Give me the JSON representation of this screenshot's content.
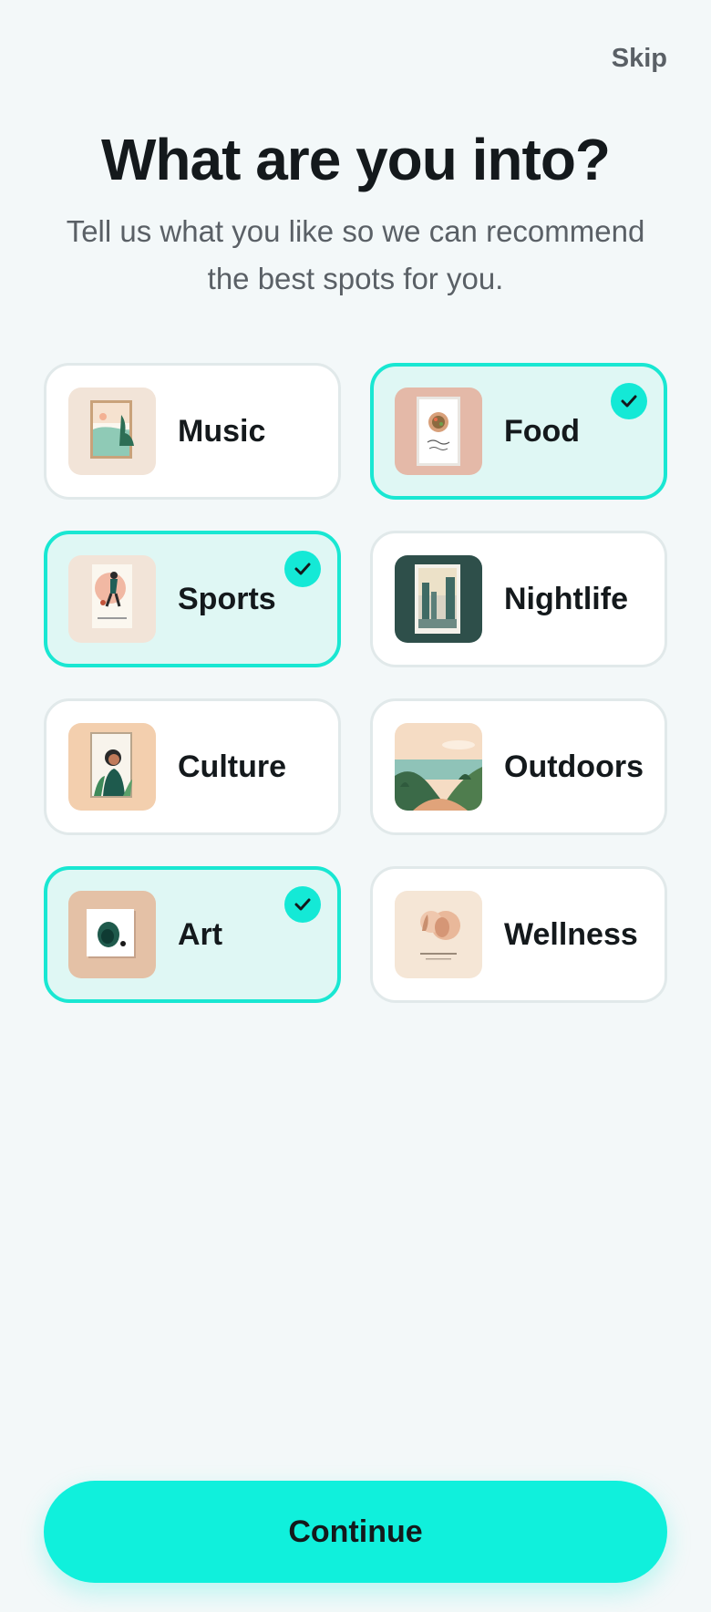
{
  "header": {
    "skip_label": "Skip",
    "title": "What are you into?",
    "subtitle": "Tell us what you like so we can recommend the best spots for you."
  },
  "categories": [
    {
      "label": "Music",
      "selected": false,
      "icon": "music-poster-icon"
    },
    {
      "label": "Food",
      "selected": true,
      "icon": "food-poster-icon"
    },
    {
      "label": "Sports",
      "selected": true,
      "icon": "sports-poster-icon"
    },
    {
      "label": "Nightlife",
      "selected": false,
      "icon": "nightlife-poster-icon"
    },
    {
      "label": "Culture",
      "selected": false,
      "icon": "culture-poster-icon"
    },
    {
      "label": "Outdoors",
      "selected": false,
      "icon": "outdoors-landscape-icon"
    },
    {
      "label": "Art",
      "selected": true,
      "icon": "art-poster-icon"
    },
    {
      "label": "Wellness",
      "selected": false,
      "icon": "wellness-poster-icon"
    }
  ],
  "footer": {
    "continue_label": "Continue"
  },
  "colors": {
    "accent": "#10f0dc",
    "selected_bg": "#dff7f4",
    "selected_border": "#19e7d2",
    "page_bg": "#f3f8f9"
  }
}
